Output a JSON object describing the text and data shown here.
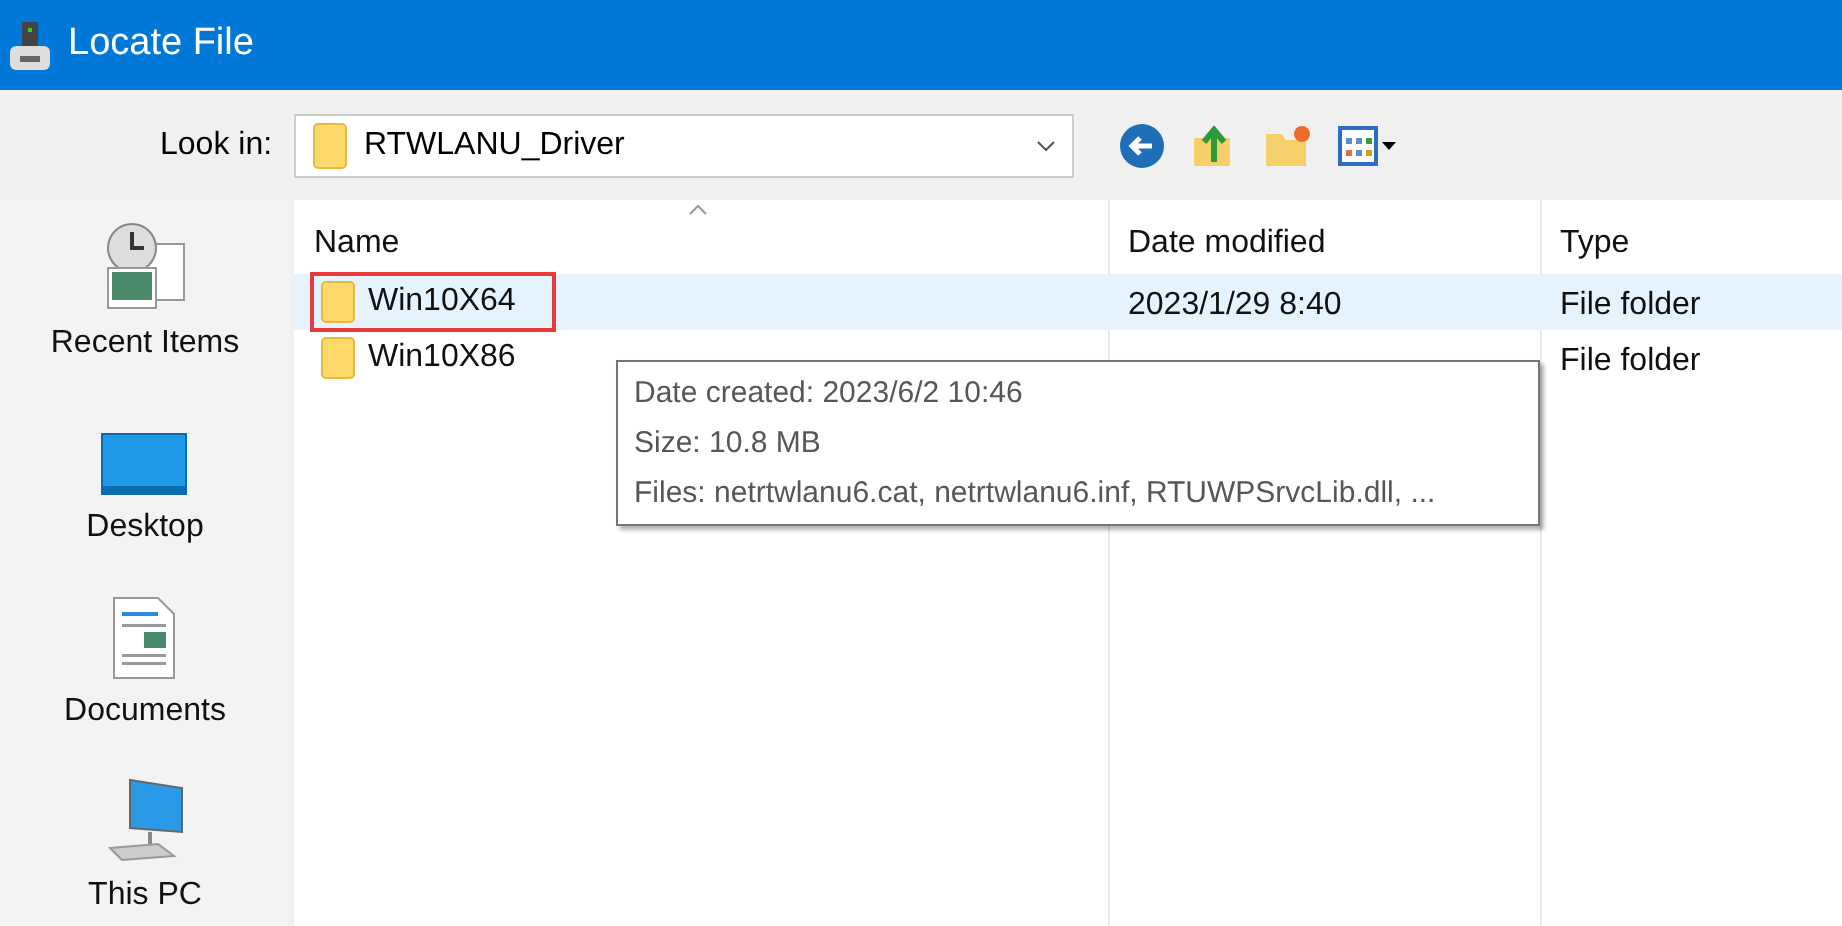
{
  "window": {
    "title": "Locate File"
  },
  "look_in": {
    "label": "Look in:",
    "value": "RTWLANU_Driver"
  },
  "sidebar": {
    "items": [
      {
        "label": "Recent Items",
        "kind": "recent"
      },
      {
        "label": "Desktop",
        "kind": "desktop"
      },
      {
        "label": "Documents",
        "kind": "documents"
      },
      {
        "label": "This PC",
        "kind": "pc"
      }
    ]
  },
  "table": {
    "columns": [
      "Name",
      "Date modified",
      "Type"
    ],
    "rows": [
      {
        "name": "Win10X64",
        "date": "2023/1/29 8:40",
        "type": "File folder",
        "selected": true,
        "annotated": true
      },
      {
        "name": "Win10X86",
        "type": "File folder",
        "selected": false,
        "annotated": false
      }
    ]
  },
  "tooltip": [
    "Date created: 2023/6/2 10:46",
    "Size: 10.8 MB",
    "Files: netrtwlanu6.cat, netrtwlanu6.inf, RTUWPSrvcLib.dll, ..."
  ]
}
